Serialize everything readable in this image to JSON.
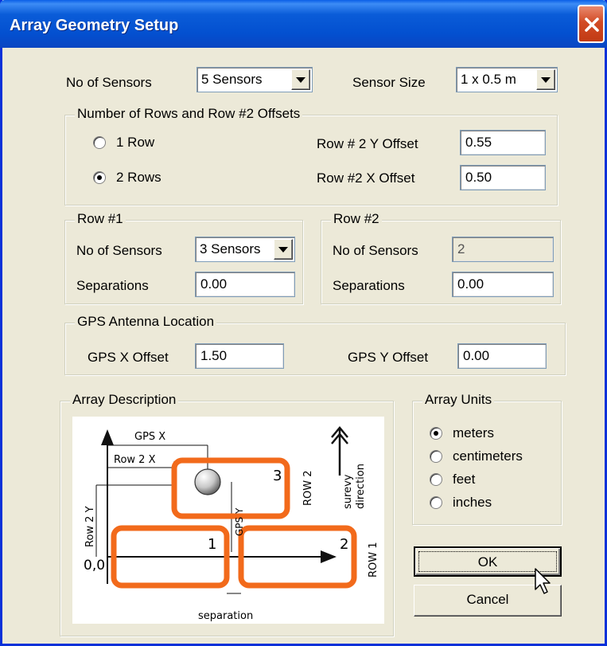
{
  "window": {
    "title": "Array Geometry Setup"
  },
  "top": {
    "sensors_label": "No of Sensors",
    "sensors_value": "5 Sensors",
    "size_label": "Sensor Size",
    "size_value": "1 x 0.5 m"
  },
  "rows_group": {
    "title": "Number of Rows and Row #2 Offsets",
    "option_1": "1 Row",
    "option_2": "2 Rows",
    "selected": "2 Rows",
    "y_offset_label": "Row # 2 Y Offset",
    "y_offset_value": "0.55",
    "x_offset_label": "Row #2 X Offset",
    "x_offset_value": "0.50"
  },
  "row1": {
    "title": "Row #1",
    "sensors_label": "No of Sensors",
    "sensors_value": "3 Sensors",
    "sep_label": "Separations",
    "sep_value": "0.00"
  },
  "row2": {
    "title": "Row #2",
    "sensors_label": "No of Sensors",
    "sensors_value": "2",
    "sep_label": "Separations",
    "sep_value": "0.00"
  },
  "gps": {
    "title": "GPS Antenna Location",
    "x_label": "GPS X Offset",
    "x_value": "1.50",
    "y_label": "GPS Y Offset",
    "y_value": "0.00"
  },
  "description": {
    "title": "Array Description",
    "labels": {
      "gps_x": "GPS X",
      "row2_x": "Row 2 X",
      "row2_y": "Row 2 Y",
      "gps_y": "GPS Y",
      "origin": "0,0",
      "separation": "separation",
      "s1": "1",
      "s2": "2",
      "s3": "3",
      "row_1": "ROW 1",
      "row_2": "ROW 2",
      "survey": "surevy",
      "direction": "direction"
    },
    "colors": {
      "sensor": "#f26a1b",
      "lines": "#111111"
    }
  },
  "units": {
    "title": "Array Units",
    "options": [
      "meters",
      "centimeters",
      "feet",
      "inches"
    ],
    "selected": "meters"
  },
  "buttons": {
    "ok": "OK",
    "cancel": "Cancel"
  }
}
